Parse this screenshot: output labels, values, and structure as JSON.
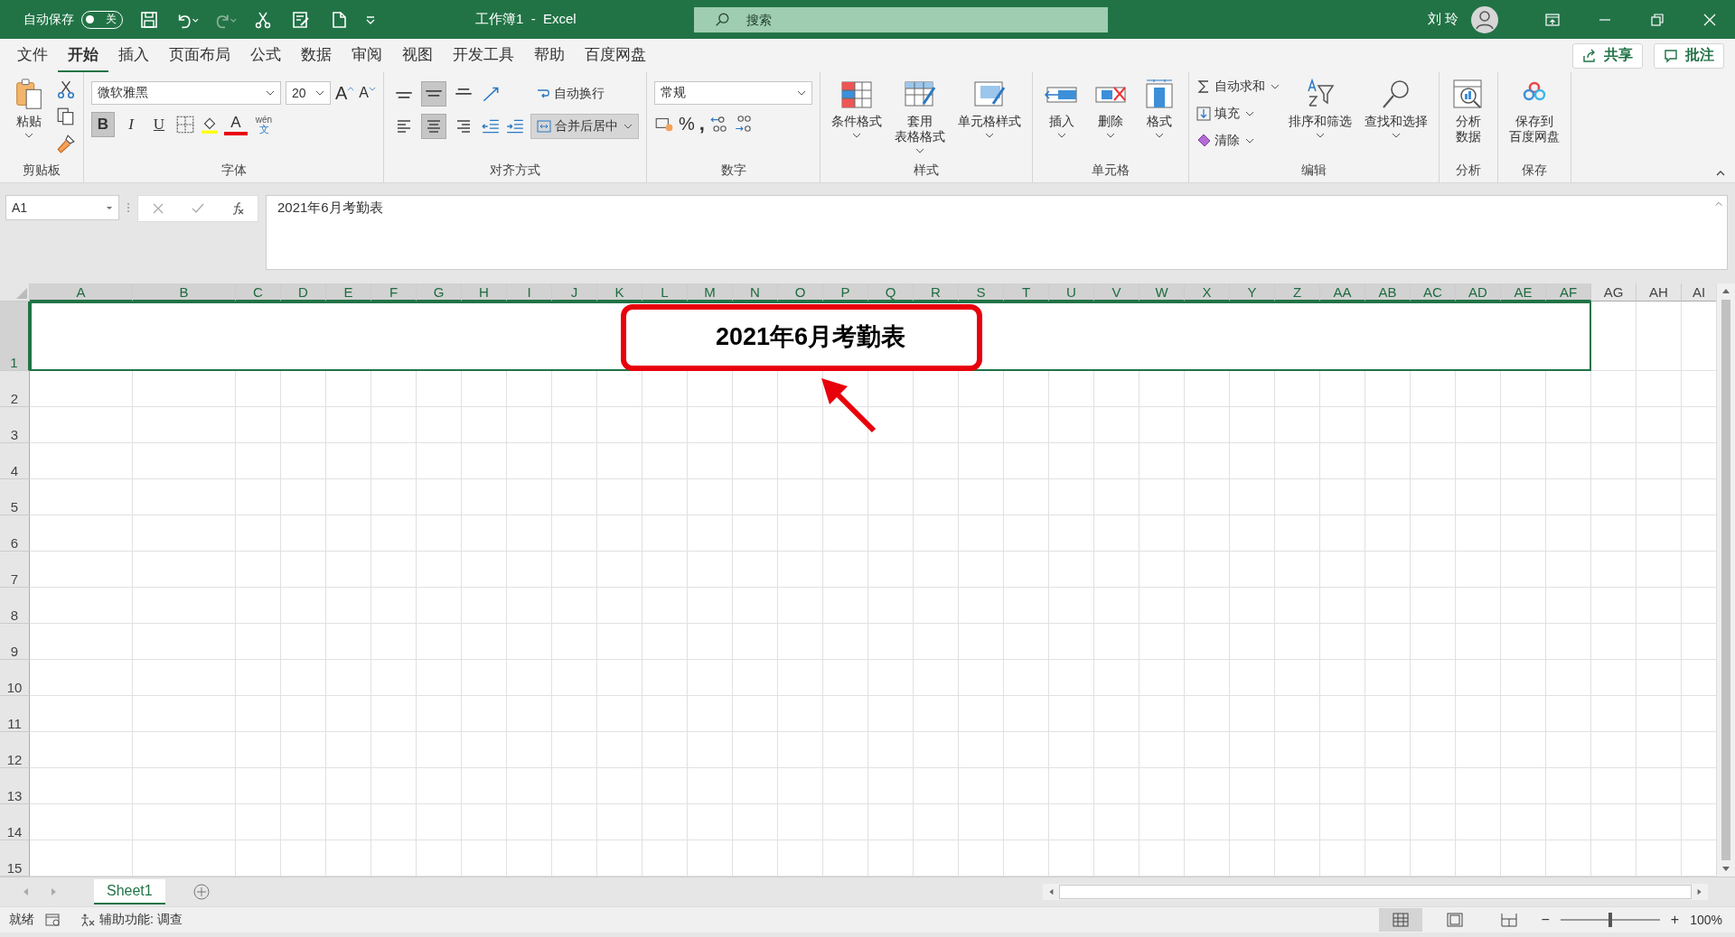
{
  "title_bar": {
    "autosave_label": "自动保存",
    "autosave": {
      "on": false,
      "label": "关"
    },
    "title": "工作簿1  -  Excel",
    "search_placeholder": "搜索",
    "user": "刘 玲"
  },
  "menu_tabs": [
    {
      "label": "文件",
      "selected": false
    },
    {
      "label": "开始",
      "selected": true
    },
    {
      "label": "插入",
      "selected": false
    },
    {
      "label": "页面布局",
      "selected": false
    },
    {
      "label": "公式",
      "selected": false
    },
    {
      "label": "数据",
      "selected": false
    },
    {
      "label": "审阅",
      "selected": false
    },
    {
      "label": "视图",
      "selected": false
    },
    {
      "label": "开发工具",
      "selected": false
    },
    {
      "label": "帮助",
      "selected": false
    },
    {
      "label": "百度网盘",
      "selected": false
    }
  ],
  "share_button": "共享",
  "comments_button": "批注",
  "ribbon": {
    "clipboard": {
      "paste": "粘贴",
      "label": "剪贴板"
    },
    "font": {
      "name": "微软雅黑",
      "size": "20",
      "grow": "A",
      "shrink": "A",
      "bold": {
        "label": "B",
        "pressed": true
      },
      "italic": {
        "label": "I",
        "pressed": false
      },
      "underline": {
        "label": "U",
        "pressed": false
      },
      "font_color": "A",
      "phonetic_top": "wén",
      "phonetic_bottom": "文",
      "label": "字体"
    },
    "alignment": {
      "vertical": [
        {
          "kind": "top",
          "pressed": false
        },
        {
          "kind": "middle",
          "pressed": true
        },
        {
          "kind": "bottom",
          "pressed": false
        }
      ],
      "horizontal": [
        {
          "kind": "left",
          "pressed": false
        },
        {
          "kind": "center",
          "pressed": true
        },
        {
          "kind": "right",
          "pressed": false
        }
      ],
      "wrap_text": "自动换行",
      "merge_center": "合并后居中",
      "label": "对齐方式"
    },
    "number": {
      "format": "常规",
      "percent": "%",
      "comma": ",",
      "label": "数字"
    },
    "styles": {
      "buttons": [
        {
          "kind": "conditional",
          "lines": [
            "条件格式"
          ]
        },
        {
          "kind": "table",
          "lines": [
            "套用",
            "表格格式"
          ]
        },
        {
          "kind": "cell_style",
          "lines": [
            "单元格样式"
          ]
        }
      ],
      "label": "样式"
    },
    "cells": {
      "buttons": [
        {
          "kind": "insert",
          "lines": [
            "插入"
          ]
        },
        {
          "kind": "delete",
          "lines": [
            "删除"
          ]
        },
        {
          "kind": "format",
          "lines": [
            "格式"
          ]
        }
      ],
      "label": "单元格"
    },
    "editing": {
      "autosum": "自动求和",
      "fill": "填充",
      "clear": "清除",
      "buttons": [
        {
          "kind": "sort",
          "lines": [
            "排序和筛选"
          ]
        },
        {
          "kind": "find",
          "lines": [
            "查找和选择"
          ]
        }
      ],
      "label": "编辑"
    },
    "analysis": {
      "buttons": [
        {
          "kind": "analyze",
          "lines": [
            "分析",
            "数据"
          ]
        }
      ],
      "label": "分析"
    },
    "save": {
      "buttons": [
        {
          "kind": "cloud",
          "lines": [
            "保存到",
            "百度网盘"
          ]
        }
      ],
      "label": "保存"
    }
  },
  "formula_bar": {
    "name_box": "A1",
    "formula": "2021年6月考勤表"
  },
  "sheet": {
    "columns": [
      {
        "label": "A",
        "selected": true
      },
      {
        "label": "B",
        "selected": true
      },
      {
        "label": "C",
        "selected": true
      },
      {
        "label": "D",
        "selected": true
      },
      {
        "label": "E",
        "selected": true
      },
      {
        "label": "F",
        "selected": true
      },
      {
        "label": "G",
        "selected": true
      },
      {
        "label": "H",
        "selected": true
      },
      {
        "label": "I",
        "selected": true
      },
      {
        "label": "J",
        "selected": true
      },
      {
        "label": "K",
        "selected": true
      },
      {
        "label": "L",
        "selected": true
      },
      {
        "label": "M",
        "selected": true
      },
      {
        "label": "N",
        "selected": true
      },
      {
        "label": "O",
        "selected": true
      },
      {
        "label": "P",
        "selected": true
      },
      {
        "label": "Q",
        "selected": true
      },
      {
        "label": "R",
        "selected": true
      },
      {
        "label": "S",
        "selected": true
      },
      {
        "label": "T",
        "selected": true
      },
      {
        "label": "U",
        "selected": true
      },
      {
        "label": "V",
        "selected": true
      },
      {
        "label": "W",
        "selected": true
      },
      {
        "label": "X",
        "selected": true
      },
      {
        "label": "Y",
        "selected": true
      },
      {
        "label": "Z",
        "selected": true
      },
      {
        "label": "AA",
        "selected": true
      },
      {
        "label": "AB",
        "selected": true
      },
      {
        "label": "AC",
        "selected": true
      },
      {
        "label": "AD",
        "selected": true
      },
      {
        "label": "AE",
        "selected": true
      },
      {
        "label": "AF",
        "selected": true
      },
      {
        "label": "AG",
        "selected": false
      },
      {
        "label": "AH",
        "selected": false
      },
      {
        "label": "AI",
        "selected": false
      }
    ],
    "rows": [
      {
        "label": "1",
        "selected": true
      },
      {
        "label": "2",
        "selected": false
      },
      {
        "label": "3",
        "selected": false
      },
      {
        "label": "4",
        "selected": false
      },
      {
        "label": "5",
        "selected": false
      },
      {
        "label": "6",
        "selected": false
      },
      {
        "label": "7",
        "selected": false
      },
      {
        "label": "8",
        "selected": false
      },
      {
        "label": "9",
        "selected": false
      },
      {
        "label": "10",
        "selected": false
      },
      {
        "label": "11",
        "selected": false
      },
      {
        "label": "12",
        "selected": false
      },
      {
        "label": "13",
        "selected": false
      },
      {
        "label": "14",
        "selected": false
      },
      {
        "label": "15",
        "selected": false
      }
    ],
    "a1": "2021年6月考勤表"
  },
  "sheet_tabs": [
    {
      "label": "Sheet1",
      "selected": true
    }
  ],
  "status_bar": {
    "ready": "就绪",
    "accessibility": "辅助功能: 调查",
    "views": [
      {
        "kind": "normal",
        "selected": true
      },
      {
        "kind": "page_layout",
        "selected": false
      },
      {
        "kind": "page_break",
        "selected": false
      }
    ],
    "zoom_out": "−",
    "zoom_in": "+",
    "zoom": {
      "level": 0.5
    },
    "zoom_text": "100%"
  }
}
